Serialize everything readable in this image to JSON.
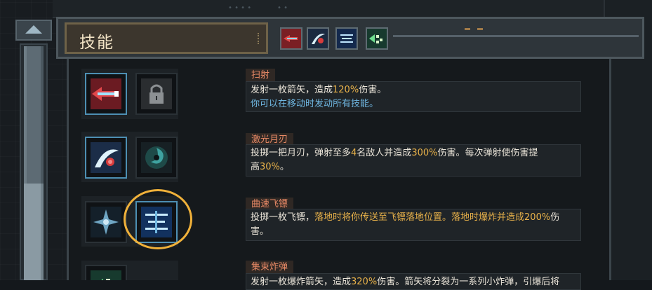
{
  "header": {
    "title": "技能",
    "tabs": [
      {
        "name": "arrow",
        "icon": "arrow-skill-icon"
      },
      {
        "name": "moon-blade",
        "icon": "moon-blade-skill-icon"
      },
      {
        "name": "boomerang",
        "icon": "boomerang-skill-icon"
      },
      {
        "name": "cluster-bomb",
        "icon": "cluster-bomb-skill-icon"
      }
    ]
  },
  "skills": [
    {
      "name": "扫射",
      "desc_parts": [
        "发射一枚箭矢，造成",
        "120%",
        "伤害。"
      ],
      "note": "你可以在移动时发动所有技能。",
      "icons": [
        "arrow-skill-icon",
        "lock-icon"
      ]
    },
    {
      "name": "激光月刃",
      "desc_parts": [
        "投掷一把月刃，弹射至多",
        "4",
        "名敌人并造成",
        "300%",
        "伤害。每次弹射使伤害提"
      ],
      "desc_line2_parts": [
        "高",
        "30%",
        "。"
      ],
      "icons": [
        "moon-blade-skill-icon",
        "vortex-skill-icon"
      ]
    },
    {
      "name": "曲速飞镖",
      "desc_parts": [
        "投掷一枚飞镖，",
        "落地时将你传送至飞镖落地位置。落地时爆炸并造成",
        "200%",
        "伤"
      ],
      "desc_line2_parts": [
        "害。"
      ],
      "icons": [
        "shuriken-skill-icon",
        "boomerang-skill-icon"
      ]
    },
    {
      "name": "集束炸弹",
      "desc_parts": [
        "发射一枚爆炸箭矢，造成",
        "320%",
        "伤害。箭矢将分裂为一系列小炸弹，引爆后将"
      ],
      "icons": [
        "cluster-bomb-skill-icon"
      ]
    }
  ],
  "colors": {
    "accent_orange": "#e98a66",
    "highlight_yellow": "#e9b24a",
    "note_blue": "#6fb6e0",
    "ring": "#f0b13a"
  }
}
